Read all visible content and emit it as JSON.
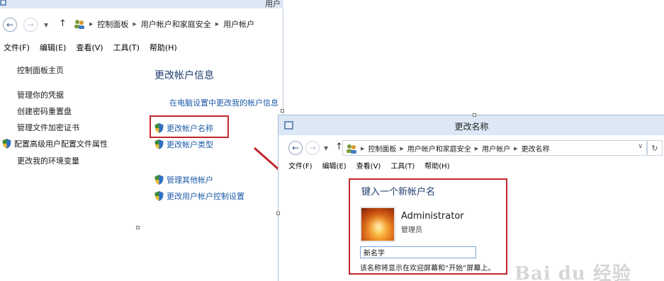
{
  "win1": {
    "title": "用户",
    "breadcrumb": [
      "控制面板",
      "用户帐户和家庭安全",
      "用户帐户"
    ],
    "menu": [
      "文件(F)",
      "编辑(E)",
      "查看(V)",
      "工具(T)",
      "帮助(H)"
    ],
    "sidebar": {
      "home": "控制面板主页",
      "items": [
        "管理你的凭据",
        "创建密码重置盘",
        "管理文件加密证书",
        "配置高级用户配置文件属性",
        "更改我的环境变量"
      ]
    },
    "heading": "更改帐户信息",
    "pc_settings_link": "在电脑设置中更改我的帐户信息",
    "links": [
      "更改帐户名称",
      "更改帐户类型"
    ],
    "links2": [
      "管理其他帐户",
      "更改用户帐户控制设置"
    ]
  },
  "win2": {
    "title": "更改名称",
    "breadcrumb": [
      "控制面板",
      "用户帐户和家庭安全",
      "用户帐户",
      "更改名称"
    ],
    "menu": [
      "文件(F)",
      "编辑(E)",
      "查看(V)",
      "工具(T)",
      "帮助(H)"
    ],
    "heading": "键入一个新帐户名",
    "account_name": "Administrator",
    "account_role": "管理员",
    "input_value": "新名字",
    "hint": "该名称将显示在欢迎屏幕和“开始”屏幕上。"
  },
  "watermark": "Bai du 经验",
  "colors": {
    "highlight": "#c1272d",
    "link": "#1d5aa8",
    "heading": "#1e3d6e"
  }
}
